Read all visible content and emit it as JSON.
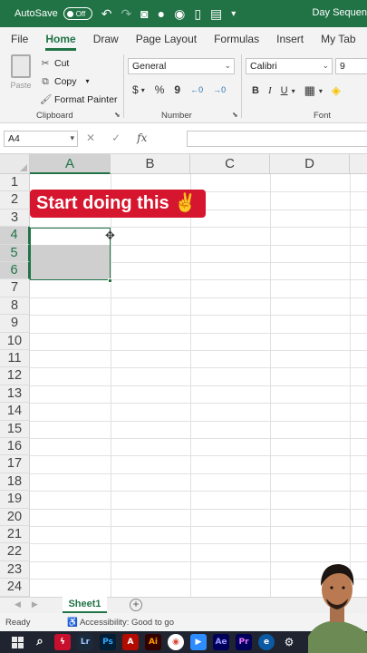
{
  "titlebar": {
    "autosave_label": "AutoSave",
    "autosave_state": "Off",
    "doc_title": "Day Sequen",
    "qat_icons": [
      "undo-icon",
      "redo-icon",
      "camera-icon",
      "circle-icon",
      "record-icon",
      "file-icon",
      "clipboard-icon",
      "customize-icon"
    ]
  },
  "tabs": [
    "File",
    "Home",
    "Draw",
    "Page Layout",
    "Formulas",
    "Insert",
    "My Tab"
  ],
  "active_tab": "Home",
  "clipboard": {
    "paste_label": "Paste",
    "cut_label": "Cut",
    "copy_label": "Copy",
    "format_painter_label": "Format Painter",
    "group_label": "Clipboard"
  },
  "number": {
    "format_value": "General",
    "group_label": "Number",
    "buttons": [
      "$",
      "%",
      "9",
      "←0",
      "→0"
    ]
  },
  "font": {
    "name_value": "Calibri",
    "size_value": "9",
    "group_label": "Font",
    "buttons": [
      "B",
      "I",
      "U"
    ]
  },
  "formula_bar": {
    "name_box": "A4",
    "cancel": "✕",
    "enter": "✓",
    "fx": "fx",
    "value": ""
  },
  "columns": [
    "A",
    "B",
    "C",
    "D"
  ],
  "rows": [
    "1",
    "2",
    "3",
    "4",
    "5",
    "6",
    "7",
    "8",
    "9",
    "10",
    "11",
    "12",
    "13",
    "14",
    "15",
    "16",
    "17",
    "18",
    "19",
    "20",
    "21",
    "22",
    "23",
    "24"
  ],
  "selected_column": "A",
  "selected_rows": [
    "4",
    "5",
    "6"
  ],
  "banner_text": "Start doing this ✌",
  "sheet_tab": "Sheet1",
  "status": {
    "ready": "Ready",
    "accessibility": "Accessibility: Good to go"
  },
  "taskbar_apps": [
    "Lr",
    "Ps",
    "Ai",
    "Ae",
    "Pr"
  ],
  "colors": {
    "excel_green": "#217346",
    "banner_red": "#d6152e",
    "selection_gray": "#cfcfcf"
  }
}
